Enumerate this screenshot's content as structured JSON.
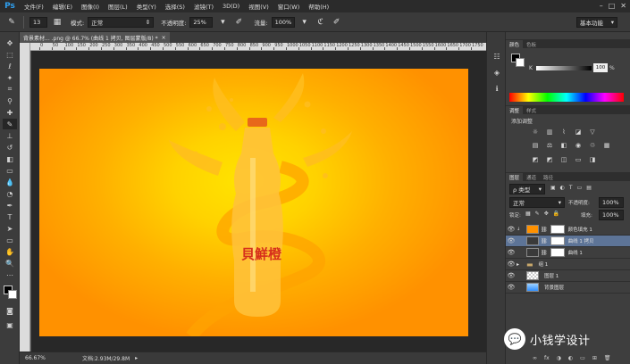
{
  "menubar": {
    "logo": "Ps",
    "items": [
      "文件(F)",
      "编辑(E)",
      "图像(I)",
      "图层(L)",
      "类型(Y)",
      "选择(S)",
      "滤镜(T)",
      "3D(D)",
      "视图(V)",
      "窗口(W)",
      "帮助(H)"
    ],
    "window_controls": [
      "–",
      "□",
      "✕"
    ]
  },
  "options": {
    "brush_size": "13",
    "mode_label": "模式:",
    "mode_value": "正常",
    "opacity_label": "不透明度:",
    "opacity_value": "25%",
    "flow_label": "流量:",
    "flow_value": "100%",
    "workspace": "基本功能"
  },
  "document": {
    "tab_title": "背景素材... .png @ 66.7% (曲线 1 拷贝, 图层蒙版/8) *",
    "close": "×"
  },
  "ruler": {
    "top_numbers": [
      "0",
      "50",
      "100",
      "150",
      "200",
      "250",
      "300",
      "350",
      "400",
      "450",
      "500",
      "550",
      "600",
      "650",
      "700",
      "750",
      "800",
      "850",
      "900",
      "950",
      "1000",
      "1050",
      "1100",
      "1150",
      "1200",
      "1250",
      "1300",
      "1350",
      "1400",
      "1450",
      "1500",
      "1550",
      "1600",
      "1650",
      "1700",
      "1750"
    ]
  },
  "status": {
    "zoom": "66.67%",
    "doc_info": "文档:2.93M/29.8M"
  },
  "artwork": {
    "brand_text": "貝鮮橙"
  },
  "color_panel": {
    "tabs": [
      "颜色",
      "色板"
    ],
    "slider_label": "K",
    "slider_value": "100",
    "percent": "%",
    "foreground": "#000000",
    "background": "#ffffff"
  },
  "adjust_panel": {
    "tabs": [
      "调整",
      "样式"
    ],
    "title": "添加调整"
  },
  "layers_panel": {
    "tabs": [
      "图层",
      "通道",
      "路径"
    ],
    "filter_value": "ρ 类型",
    "blend_mode": "正常",
    "opacity_label": "不透明度:",
    "opacity_value": "100%",
    "lock_label": "锁定:",
    "fill_label": "填充:",
    "fill_value": "100%",
    "layers": [
      {
        "name": "颜色填充 1",
        "thumb": "#ff9100",
        "selected": false
      },
      {
        "name": "曲线 1 拷贝",
        "thumb": "#ffffff",
        "selected": true
      },
      {
        "name": "曲线 1",
        "thumb": "#ffffff",
        "selected": false
      },
      {
        "name": "组 1",
        "thumb": "",
        "selected": false
      },
      {
        "name": "图层 1",
        "thumb": "#cccccc",
        "selected": false
      },
      {
        "name": "背景图层",
        "thumb": "#6fb6ff",
        "selected": false
      }
    ],
    "footer_icons": [
      "∞",
      "fx",
      "◑",
      "◐",
      "▭",
      "⊞",
      "🗑"
    ]
  },
  "watermark": {
    "icon": "💬",
    "text": "小钱学设计"
  }
}
